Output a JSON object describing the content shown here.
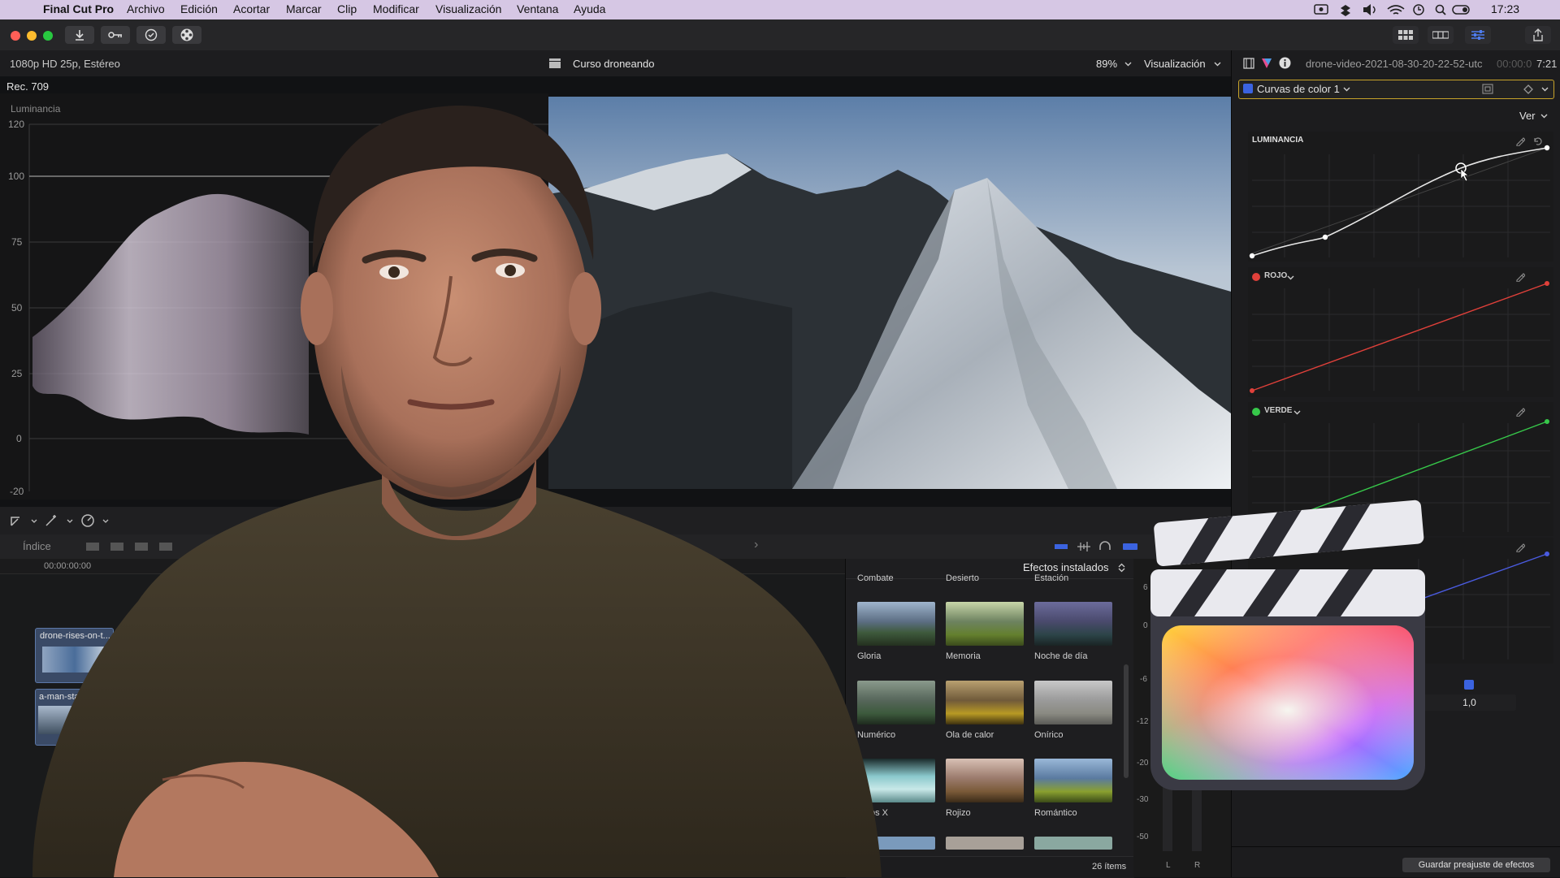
{
  "menubar": {
    "app_name": "Final Cut Pro",
    "items": [
      "Archivo",
      "Edición",
      "Acortar",
      "Marcar",
      "Clip",
      "Modificar",
      "Visualización",
      "Ventana",
      "Ayuda"
    ],
    "clock": "17:23"
  },
  "viewer": {
    "format": "1080p HD 25p, Estéreo",
    "project": "Curso droneando",
    "zoom": "89%",
    "view_menu": "Visualización",
    "color_space": "Rec. 709"
  },
  "scope": {
    "title": "Luminancia",
    "ticks": [
      "120",
      "100",
      "75",
      "50",
      "25",
      "0",
      "-20"
    ]
  },
  "inspector": {
    "clip_name": "drone-video-2021-08-30-20-22-52-utc",
    "timecode": "7:21",
    "timecode_dim": "00:00:0",
    "effect_name": "Curvas de color 1",
    "view_label": "Ver",
    "curves": {
      "luminance": "LUMINANCIA",
      "red": "ROJO",
      "green": "VERDE"
    },
    "mix_value": "1,0",
    "save_preset": "Guardar preajuste de efectos"
  },
  "timeline": {
    "index_label": "Índice",
    "timecode": "00:00:00:00",
    "clips": [
      "drone-rises-on-t...",
      "a-man-stands-"
    ]
  },
  "effects": {
    "header": "Efectos instalados",
    "top_row": [
      "Combate",
      "Desierto",
      "Estación"
    ],
    "items": [
      "Gloria",
      "Memoria",
      "Noche de día",
      "Numérico",
      "Ola de calor",
      "Onírico",
      "os X",
      "Rojizo",
      "Romántico"
    ],
    "count": "26 ítems"
  },
  "meters": {
    "ticks": [
      "6",
      "0",
      "-6",
      "-12",
      "-20",
      "-30",
      "-50"
    ],
    "left": "L",
    "right": "R"
  },
  "colors": {
    "accent_blue": "#3b63e0",
    "effect_outline": "#c7a32a",
    "red_curve": "#e0403a",
    "green_curve": "#37c84a",
    "blue_curve": "#4a5be0"
  }
}
